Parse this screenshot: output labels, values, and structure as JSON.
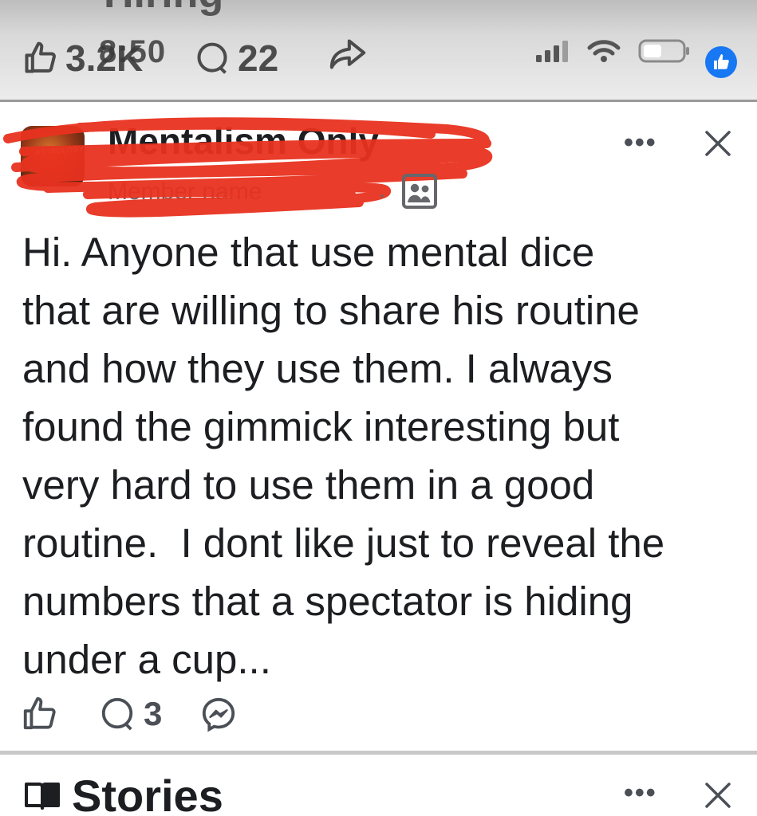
{
  "previous_post": {
    "title_fragment": "Hiring",
    "likes": "3.2K",
    "comments": "22"
  },
  "status_bar": {
    "time": "8:50"
  },
  "post": {
    "group_name": "Mentalism Only",
    "author": "Member name",
    "body": "Hi. Anyone that use mental dice\nthat are willing to share his routine\nand how they use them. I always\nfound the gimmick interesting but\nvery hard to use them in a good\nroutine.  I dont like just to reveal the\nnumbers that a spectator is hiding\nunder a cup...",
    "comment_count": "3",
    "more_label": "•••"
  },
  "stories": {
    "title": "Stories",
    "more_label": "•••"
  },
  "colors": {
    "facebook_blue": "#1877f2",
    "redaction_red": "#e8321f"
  }
}
